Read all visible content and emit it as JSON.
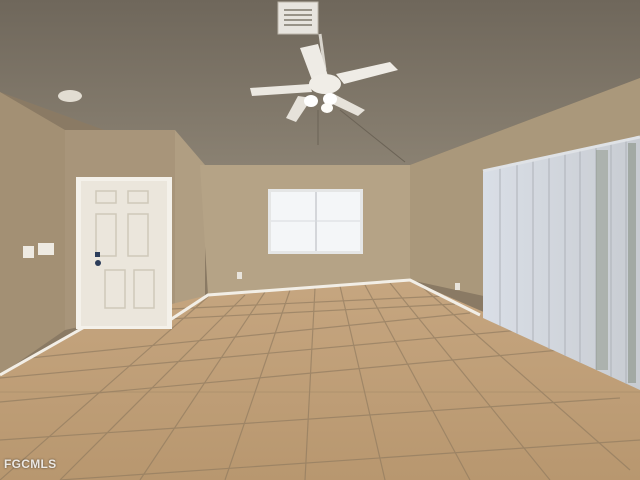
{
  "watermark": {
    "text": "FGCMLS"
  },
  "scene": {
    "description_colors": {
      "ceiling": "#7d7466",
      "wall_left": "#a8977a",
      "wall_back": "#b3a184",
      "wall_right": "#ad9c7e",
      "floor": "#c9a883",
      "grout": "#8f7a5f",
      "door": "#eeeae2",
      "blinds": "#e4e8ee",
      "window": "#f4f6f8",
      "baseboard": "#f2eee6"
    }
  }
}
